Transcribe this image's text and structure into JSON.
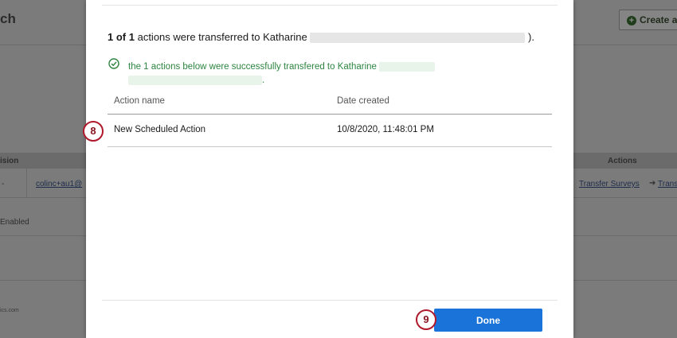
{
  "background": {
    "page_title": "ch",
    "create_button_label": "Create a",
    "table": {
      "col_vision": "ision",
      "col_actions": "Actions",
      "row": {
        "dash": "-",
        "email": "colinc+au1@",
        "transfer_surveys": "Transfer Surveys",
        "arrow": "➔",
        "transfer_more": "Trans"
      },
      "status": "Enabled"
    },
    "footnote": "ics.com"
  },
  "modal": {
    "heading": {
      "count": "1 of 1",
      "text": "actions were transferred to Katharine",
      "suffix": ")."
    },
    "success": {
      "line1": "the 1 actions below were successfully transfered to Katharine",
      "end": "."
    },
    "table": {
      "headers": {
        "name": "Action name",
        "date": "Date created"
      },
      "rows": [
        {
          "name": "New Scheduled Action",
          "date": "10/8/2020, 11:48:01 PM"
        }
      ]
    },
    "done_label": "Done"
  },
  "badges": {
    "row": "8",
    "done": "9"
  },
  "colors": {
    "accent": "#1a73d9",
    "success": "#2e8540",
    "badge_border": "#b0192b"
  }
}
